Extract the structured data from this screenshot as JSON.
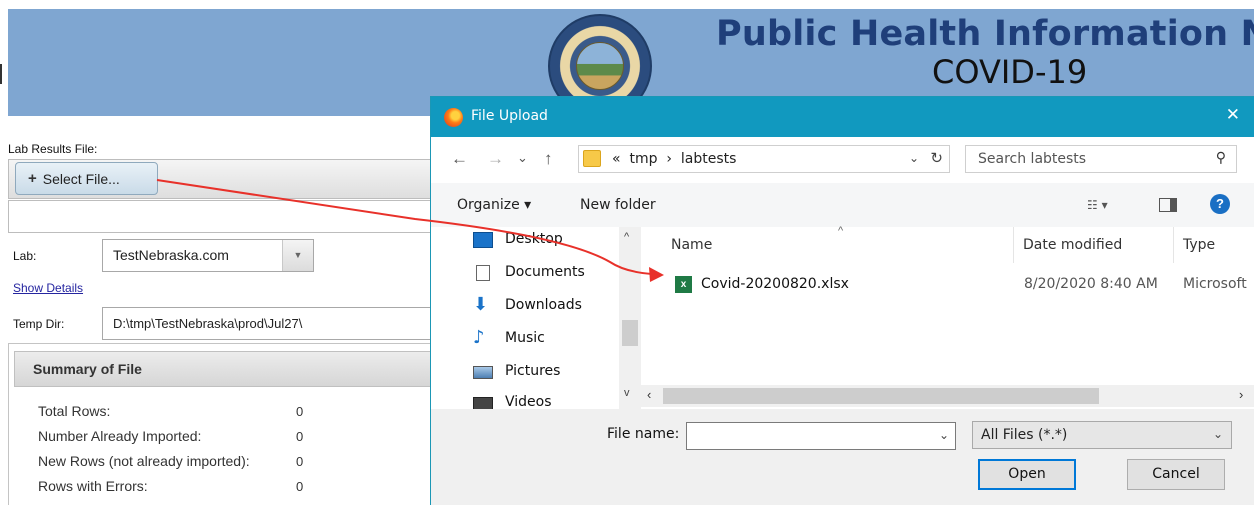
{
  "banner": {
    "title": "Public Health Information Net",
    "subtitle": "COVID-19",
    "background": "#7fa6d1",
    "title_color": "#1f3f7a"
  },
  "form": {
    "lab_results_label": "Lab Results File:",
    "select_file_label": "Select File...",
    "lab_label": "Lab:",
    "lab_value": "TestNebraska.com",
    "show_details_link": "Show Details",
    "temp_dir_label": "Temp Dir:",
    "temp_dir_value": "D:\\tmp\\TestNebraska\\prod\\Jul27\\",
    "summary_title": "Summary of File",
    "summary_rows": [
      {
        "label": "Total Rows:",
        "value": "0"
      },
      {
        "label": "Number Already Imported:",
        "value": "0"
      },
      {
        "label": "New Rows (not already imported):",
        "value": "0"
      },
      {
        "label": "Rows with Errors:",
        "value": "0"
      }
    ]
  },
  "dialog": {
    "title": "File Upload",
    "close": "✕",
    "nav": {
      "back": "←",
      "forward": "→",
      "recent": "⌄",
      "up": "↑"
    },
    "breadcrumb": {
      "overflow": "«",
      "parts": [
        "tmp",
        "labtests"
      ],
      "sep": "›"
    },
    "search_placeholder": "Search labtests",
    "toolbar": {
      "organize": "Organize ▾",
      "new_folder": "New folder",
      "help": "?"
    },
    "tree": [
      {
        "label": "Desktop",
        "icon": "desktop-icon"
      },
      {
        "label": "Documents",
        "icon": "documents-icon"
      },
      {
        "label": "Downloads",
        "icon": "downloads-icon"
      },
      {
        "label": "Music",
        "icon": "music-icon"
      },
      {
        "label": "Pictures",
        "icon": "pictures-icon"
      },
      {
        "label": "Videos",
        "icon": "videos-icon"
      }
    ],
    "columns": {
      "name": "Name",
      "date": "Date modified",
      "type": "Type"
    },
    "files": [
      {
        "name": "Covid-20200820.xlsx",
        "date": "8/20/2020 8:40 AM",
        "type": "Microsoft"
      }
    ],
    "file_name_label": "File name:",
    "file_name_value": "",
    "file_type": "All Files (*.*)",
    "open_label": "Open",
    "cancel_label": "Cancel",
    "title_color": "#1199bf"
  },
  "annotation": {
    "arrow_color": "#e8312a"
  }
}
